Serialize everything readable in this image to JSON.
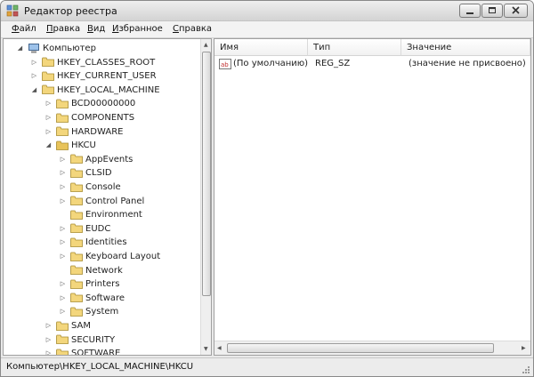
{
  "window": {
    "title": "Редактор реестра"
  },
  "menu": [
    {
      "key": "Ф",
      "rest": "айл"
    },
    {
      "key": "П",
      "rest": "равка"
    },
    {
      "key": "В",
      "rest": "ид"
    },
    {
      "key": "И",
      "rest": "збранное"
    },
    {
      "key": "С",
      "rest": "правка"
    }
  ],
  "tree": {
    "nodes": [
      {
        "label": "Компьютер",
        "expander": "expanded",
        "icon": "computer-icon"
      },
      {
        "label": "HKEY_CLASSES_ROOT",
        "expander": "collapsed",
        "icon": "folder-icon"
      },
      {
        "label": "HKEY_CURRENT_USER",
        "expander": "collapsed",
        "icon": "folder-icon"
      },
      {
        "label": "HKEY_LOCAL_MACHINE",
        "expander": "expanded",
        "icon": "folder-icon"
      },
      {
        "label": "BCD00000000",
        "expander": "collapsed",
        "icon": "folder-icon"
      },
      {
        "label": "COMPONENTS",
        "expander": "collapsed",
        "icon": "folder-icon"
      },
      {
        "label": "HARDWARE",
        "expander": "collapsed",
        "icon": "folder-icon"
      },
      {
        "label": "HKCU",
        "expander": "expanded",
        "icon": "folder-icon",
        "selected": true
      },
      {
        "label": "AppEvents",
        "expander": "collapsed",
        "icon": "folder-icon"
      },
      {
        "label": "CLSID",
        "expander": "collapsed",
        "icon": "folder-icon"
      },
      {
        "label": "Console",
        "expander": "collapsed",
        "icon": "folder-icon"
      },
      {
        "label": "Control Panel",
        "expander": "collapsed",
        "icon": "folder-icon"
      },
      {
        "label": "Environment",
        "expander": "none",
        "icon": "folder-icon"
      },
      {
        "label": "EUDC",
        "expander": "collapsed",
        "icon": "folder-icon"
      },
      {
        "label": "Identities",
        "expander": "collapsed",
        "icon": "folder-icon"
      },
      {
        "label": "Keyboard Layout",
        "expander": "collapsed",
        "icon": "folder-icon"
      },
      {
        "label": "Network",
        "expander": "none",
        "icon": "folder-icon"
      },
      {
        "label": "Printers",
        "expander": "collapsed",
        "icon": "folder-icon"
      },
      {
        "label": "Software",
        "expander": "collapsed",
        "icon": "folder-icon"
      },
      {
        "label": "System",
        "expander": "collapsed",
        "icon": "folder-icon"
      },
      {
        "label": "SAM",
        "expander": "collapsed",
        "icon": "folder-icon"
      },
      {
        "label": "SECURITY",
        "expander": "collapsed",
        "icon": "folder-icon"
      },
      {
        "label": "SOFTWARE",
        "expander": "collapsed",
        "icon": "folder-icon"
      }
    ]
  },
  "list": {
    "columns": [
      "Имя",
      "Тип",
      "Значение"
    ],
    "rows": [
      {
        "icon": "string-value-icon",
        "name": "(По умолчанию)",
        "type": "REG_SZ",
        "value": "(значение не присвоено)"
      }
    ]
  },
  "status": {
    "path": "Компьютер\\HKEY_LOCAL_MACHINE\\HKCU"
  }
}
